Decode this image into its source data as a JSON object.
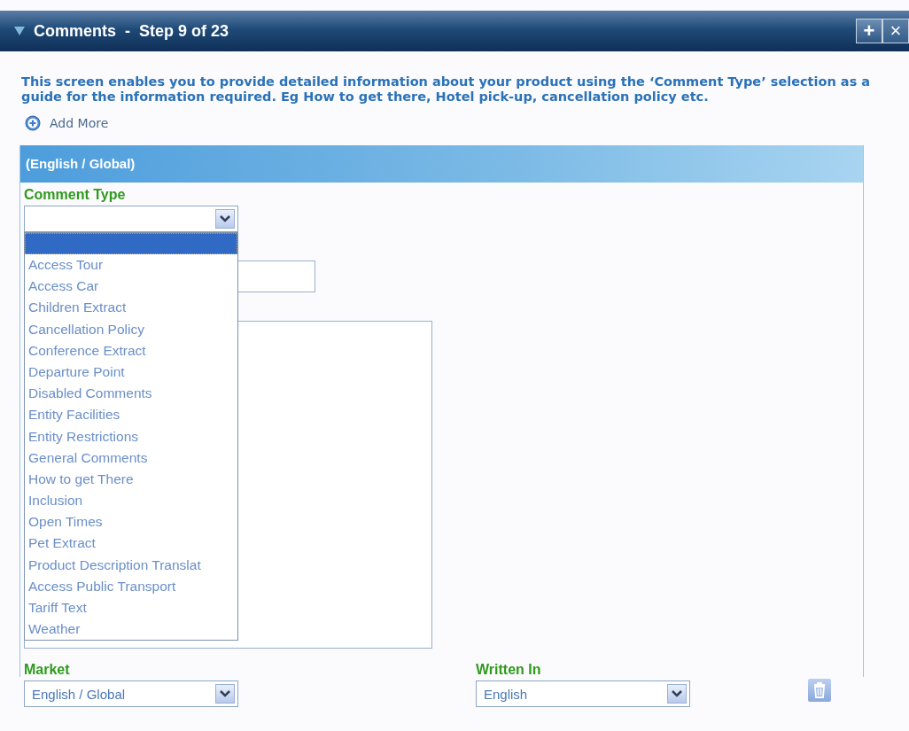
{
  "window": {
    "title": "Comments",
    "step": "Step 9 of 23",
    "separator": "-",
    "buttons": [
      {
        "kind": "add",
        "label": "+"
      },
      {
        "kind": "close",
        "label": "×"
      }
    ]
  },
  "intro": "This screen enables you to provide detailed information about your product using the ‘Comment Type’ selection as a guide for the information required. Eg How to get there, Hotel pick-up, cancellation policy etc.",
  "add_more": "Add More",
  "section": {
    "title": "(English / Global)",
    "comment_type": {
      "label": "Comment Type",
      "expanded": true,
      "blank_option_highlighted": true,
      "options": [
        {
          "label": "Access Tour",
          "selected": false
        },
        {
          "label": "Access Car",
          "selected": false
        },
        {
          "label": "Children Extract",
          "selected": false
        },
        {
          "label": "Cancellation Policy",
          "selected": false
        },
        {
          "label": "Conference Extract",
          "selected": false
        },
        {
          "label": "Departure Point",
          "selected": false
        },
        {
          "label": "Disabled Comments",
          "selected": false
        },
        {
          "label": "Entity Facilities",
          "selected": false
        },
        {
          "label": "Entity Restrictions",
          "selected": false
        },
        {
          "label": "General Comments",
          "selected": false
        },
        {
          "label": "How to get There",
          "selected": false
        },
        {
          "label": "Inclusion",
          "selected": false
        },
        {
          "label": "Open Times",
          "selected": false
        },
        {
          "label": "Pet Extract",
          "selected": false
        },
        {
          "label": "Product Description Translat",
          "selected": false
        },
        {
          "label": "Access Public Transport",
          "selected": false
        },
        {
          "label": "Tariff Text",
          "selected": false
        },
        {
          "label": "Weather",
          "selected": false
        }
      ]
    },
    "market": {
      "label": "Market",
      "value": "English / Global"
    },
    "written_in": {
      "label": "Written In",
      "value": "English"
    }
  }
}
